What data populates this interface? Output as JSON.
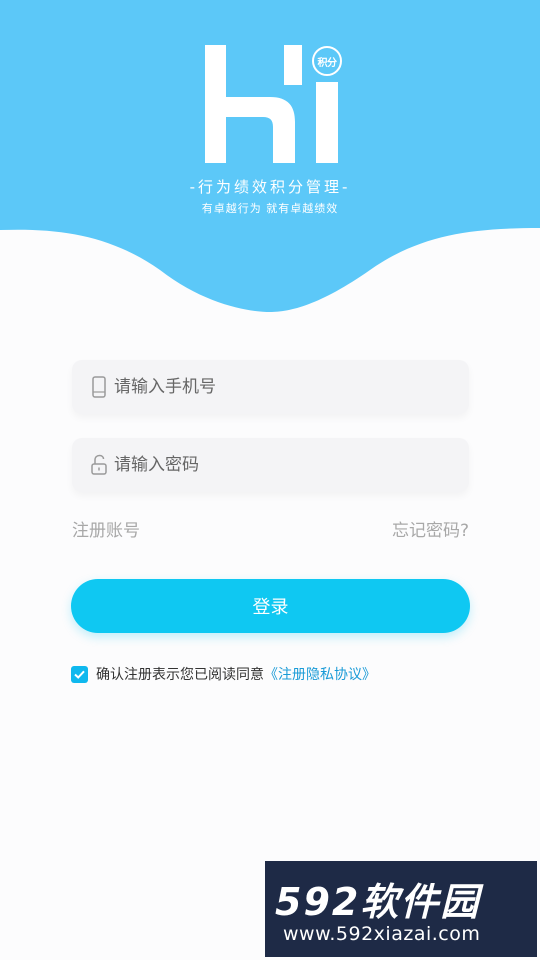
{
  "brand": {
    "logo_text": "Hi",
    "badge": "积分",
    "slogan": "-行为绩效积分管理-",
    "sub_slogan": "有卓越行为 就有卓越绩效",
    "color_primary": "#5cc8f8"
  },
  "form": {
    "phone_placeholder": "请输入手机号",
    "password_placeholder": "请输入密码",
    "register_link": "注册账号",
    "forgot_link": "忘记密码?",
    "login_label": "登录",
    "button_color": "#0fc8f2"
  },
  "agreement": {
    "checked": true,
    "text": "确认注册表示您已阅读同意",
    "link": "《注册隐私协议》"
  },
  "watermark": {
    "title": "592软件园",
    "url": "www.592xiazai.com"
  }
}
